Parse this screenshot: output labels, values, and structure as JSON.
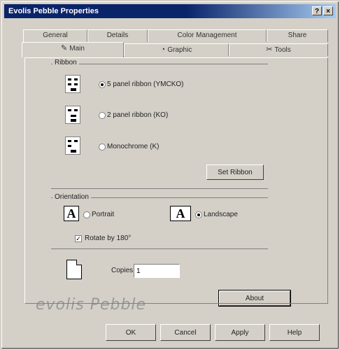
{
  "window": {
    "title": "Evolis Pebble Properties",
    "help_btn": "?",
    "close_btn": "×"
  },
  "tabs_back": [
    {
      "label": "General"
    },
    {
      "label": "Details"
    },
    {
      "label": "Color Management"
    },
    {
      "label": "Share"
    }
  ],
  "tabs_front": [
    {
      "label": "Main",
      "icon": "✎"
    },
    {
      "label": "Graphic",
      "icon": "◔"
    },
    {
      "label": "Tools",
      "icon": "✂"
    }
  ],
  "ribbon": {
    "label": "Ribbon",
    "options": [
      {
        "label": "5 panel ribbon (YMCKO)",
        "selected": true
      },
      {
        "label": "2 panel ribbon (KO)",
        "selected": false
      },
      {
        "label": "Monochrome (K)",
        "selected": false
      }
    ],
    "set_ribbon": "Set Ribbon"
  },
  "orientation": {
    "label": "Orientation",
    "portrait": "Portrait",
    "landscape": "Landscape",
    "portrait_selected": false,
    "landscape_selected": true,
    "rotate": "Rotate by 180°",
    "rotate_checked": true,
    "glyph": "A"
  },
  "copies": {
    "label": "Copies",
    "value": "1"
  },
  "about": "About",
  "logo": "evolis Pebble",
  "buttons": {
    "ok": "OK",
    "cancel": "Cancel",
    "apply": "Apply",
    "help": "Help"
  }
}
